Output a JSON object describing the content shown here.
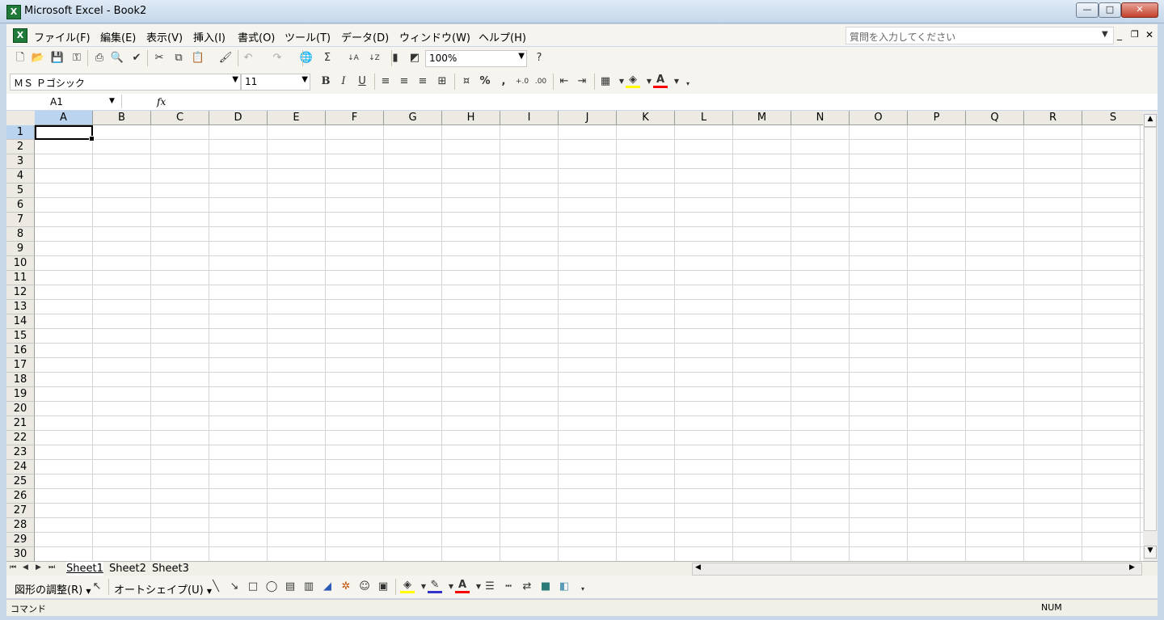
{
  "window": {
    "title": "Microsoft Excel - Book2",
    "min_label": "—",
    "max_label": "□",
    "close_label": "✕"
  },
  "menubar": {
    "items": [
      "ファイル(F)",
      "編集(E)",
      "表示(V)",
      "挿入(I)",
      "書式(O)",
      "ツール(T)",
      "データ(D)",
      "ウィンドウ(W)",
      "ヘルプ(H)"
    ],
    "ask_placeholder": "質問を入力してください"
  },
  "standard_toolbar": {
    "zoom": "100%",
    "icons": [
      "new-icon",
      "open-icon",
      "save-icon",
      "permission-icon",
      "print-icon",
      "print-preview-icon",
      "spelling-icon",
      "cut-icon",
      "copy-icon",
      "paste-icon",
      "format-painter-icon",
      "undo-icon",
      "redo-icon",
      "hyperlink-icon",
      "autosum-icon",
      "sort-ascending-icon",
      "sort-descending-icon",
      "chart-wizard-icon",
      "drawing-icon",
      "help-icon"
    ]
  },
  "format_toolbar": {
    "font": "ＭＳ Ｐゴシック",
    "size": "11",
    "bold": "B",
    "italic": "I",
    "underline": "U",
    "percent": "%",
    "comma": ","
  },
  "formula_bar": {
    "name_box": "A1",
    "fx": "fx",
    "value": ""
  },
  "grid": {
    "columns": [
      "A",
      "B",
      "C",
      "D",
      "E",
      "F",
      "G",
      "H",
      "I",
      "J",
      "K",
      "L",
      "M",
      "N",
      "O",
      "P",
      "Q",
      "R",
      "S"
    ],
    "rows": [
      "1",
      "2",
      "3",
      "4",
      "5",
      "6",
      "7",
      "8",
      "9",
      "10",
      "11",
      "12",
      "13",
      "14",
      "15",
      "16",
      "17",
      "18",
      "19",
      "20",
      "21",
      "22",
      "23",
      "24",
      "25",
      "26",
      "27",
      "28",
      "29",
      "30"
    ],
    "active_cell": "A1"
  },
  "sheets": [
    "Sheet1",
    "Sheet2",
    "Sheet3"
  ],
  "active_sheet": "Sheet1",
  "drawing_toolbar": {
    "draw_menu": "図形の調整(R)",
    "autoshapes": "オートシェイプ(U)"
  },
  "status": {
    "left": "コマンド",
    "right": "NUM"
  },
  "colors": {
    "selected_header": "#bad3ee",
    "app_green": "#1f7a3a"
  }
}
